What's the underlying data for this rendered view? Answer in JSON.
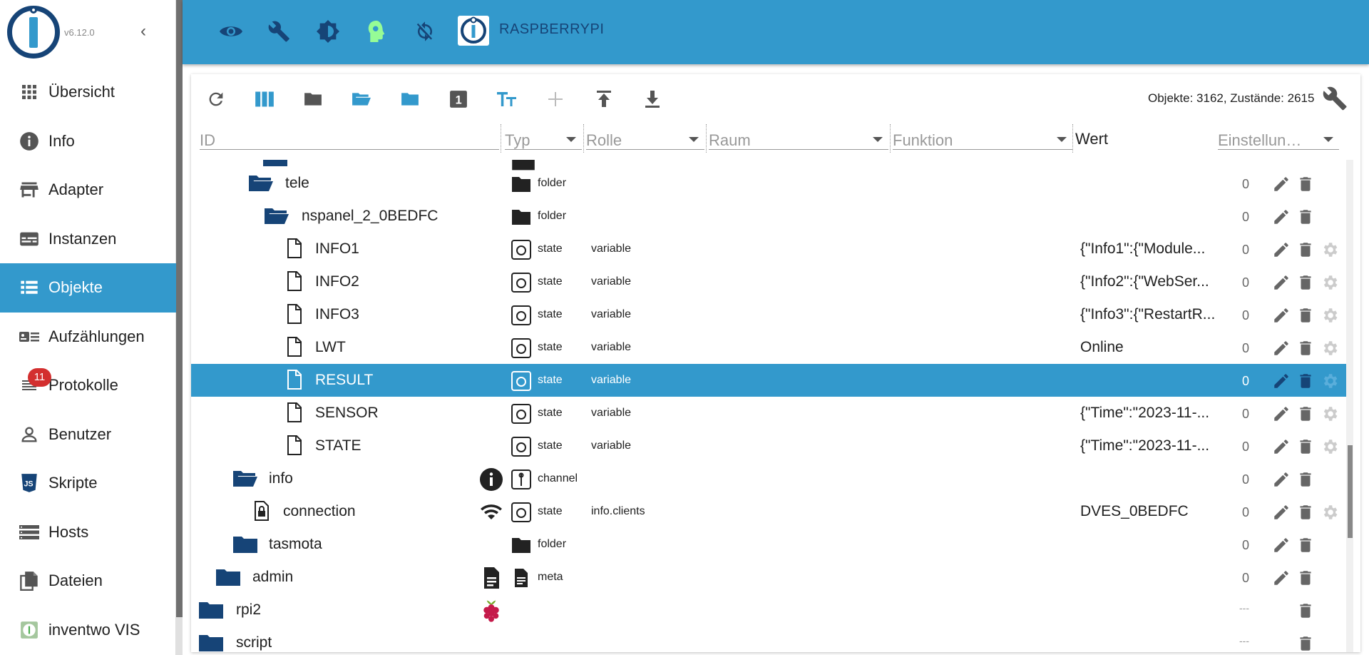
{
  "app": {
    "version": "v6.12.0",
    "host": "RASPBERRYPI"
  },
  "sidebar": {
    "items": [
      {
        "label": "Übersicht",
        "icon": "apps-icon"
      },
      {
        "label": "Info",
        "icon": "info-icon"
      },
      {
        "label": "Adapter",
        "icon": "store-icon"
      },
      {
        "label": "Instanzen",
        "icon": "instances-icon"
      },
      {
        "label": "Objekte",
        "icon": "list-icon",
        "active": true
      },
      {
        "label": "Aufzählungen",
        "icon": "enum-icon"
      },
      {
        "label": "Protokolle",
        "icon": "log-icon",
        "badge": "11"
      },
      {
        "label": "Benutzer",
        "icon": "user-icon"
      },
      {
        "label": "Skripte",
        "icon": "js-icon"
      },
      {
        "label": "Hosts",
        "icon": "hosts-icon"
      },
      {
        "label": "Dateien",
        "icon": "files-icon"
      },
      {
        "label": "inventwo VIS",
        "icon": "inventwo-icon"
      }
    ]
  },
  "toolbar": {
    "stats": "Objekte: 3162, Zustände: 2615"
  },
  "filters": {
    "id": "ID",
    "typ": "Typ",
    "rolle": "Rolle",
    "raum": "Raum",
    "funktion": "Funktion",
    "wert": "Wert",
    "einstellungen": "Einstellun…"
  },
  "rows": [
    {
      "name": "tele",
      "type": "folder",
      "role": "",
      "value": "",
      "count": "0"
    },
    {
      "name": "nspanel_2_0BEDFC",
      "type": "folder",
      "role": "",
      "value": "",
      "count": "0"
    },
    {
      "name": "INFO1",
      "type": "state",
      "role": "variable",
      "value": "{\"Info1\":{\"Module...",
      "count": "0"
    },
    {
      "name": "INFO2",
      "type": "state",
      "role": "variable",
      "value": "{\"Info2\":{\"WebSer...",
      "count": "0"
    },
    {
      "name": "INFO3",
      "type": "state",
      "role": "variable",
      "value": "{\"Info3\":{\"RestartR...",
      "count": "0"
    },
    {
      "name": "LWT",
      "type": "state",
      "role": "variable",
      "value": "Online",
      "count": "0"
    },
    {
      "name": "RESULT",
      "type": "state",
      "role": "variable",
      "value": "",
      "count": "0"
    },
    {
      "name": "SENSOR",
      "type": "state",
      "role": "variable",
      "value": "{\"Time\":\"2023-11-...",
      "count": "0"
    },
    {
      "name": "STATE",
      "type": "state",
      "role": "variable",
      "value": "{\"Time\":\"2023-11-...",
      "count": "0"
    },
    {
      "name": "info",
      "type": "channel",
      "role": "",
      "value": "",
      "count": "0"
    },
    {
      "name": "connection",
      "type": "state",
      "role": "info.clients",
      "value": "DVES_0BEDFC",
      "count": "0"
    },
    {
      "name": "tasmota",
      "type": "folder",
      "role": "",
      "value": "",
      "count": "0"
    },
    {
      "name": "admin",
      "type": "meta",
      "role": "",
      "value": "",
      "count": "0"
    },
    {
      "name": "rpi2",
      "type": "",
      "role": "",
      "value": "",
      "count": "---"
    },
    {
      "name": "script",
      "type": "",
      "role": "",
      "value": "",
      "count": "---"
    }
  ]
}
